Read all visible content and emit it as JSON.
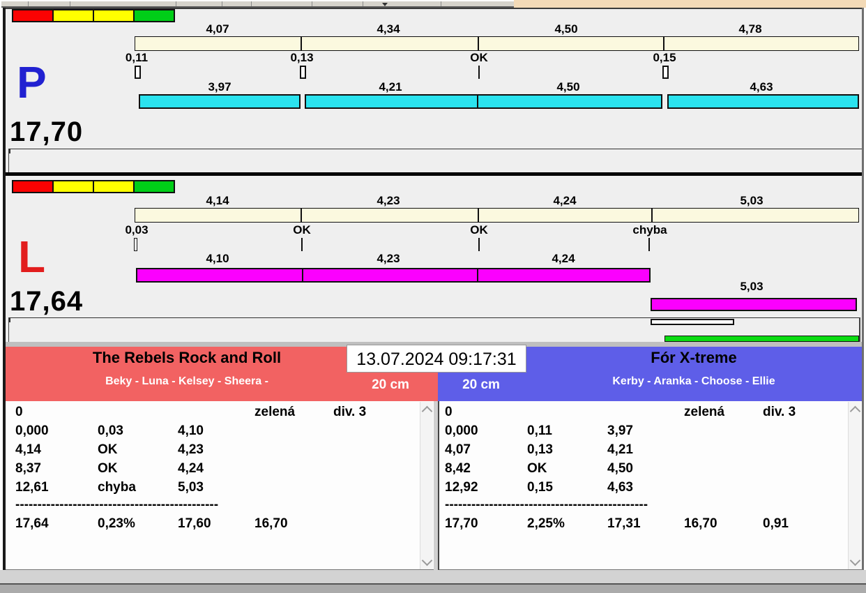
{
  "legend_colors": [
    "#FA0202",
    "#FFFF00",
    "#FFFF00",
    "#00CE18"
  ],
  "lanes": {
    "p": {
      "letter": "P",
      "letter_color": "#2121D1",
      "total": "17,70",
      "bar_color": "#2BE3EF",
      "upper": [
        "4,07",
        "4,34",
        "4,50",
        "4,78"
      ],
      "ticks": [
        {
          "label": "0,11"
        },
        {
          "label": "0,13"
        },
        {
          "label": "OK"
        },
        {
          "label": "0,15"
        }
      ],
      "lower": [
        "3,97",
        "4,21",
        "4,50",
        "4,63"
      ]
    },
    "l": {
      "letter": "L",
      "letter_color": "#E21D1D",
      "total": "17,64",
      "bar_color": "#FB00FE",
      "upper": [
        "4,14",
        "4,23",
        "4,24",
        "5,03"
      ],
      "ticks": [
        {
          "label": "0,03"
        },
        {
          "label": "OK"
        },
        {
          "label": "OK"
        },
        {
          "label": "chyba"
        }
      ],
      "lower": [
        "4,10",
        "4,23",
        "4,24"
      ],
      "overflow_label": "5,03",
      "rerun_bar_color": "#0BDC12"
    }
  },
  "timestamp": "13.07.2024 09:17:31",
  "teams": {
    "left": {
      "name": "The Rebels Rock and Roll",
      "dogs": "Beky - Luna - Kelsey - Sheera -",
      "height_class": "20 cm",
      "header_color": "#F26262",
      "rows": [
        [
          "0",
          "",
          "",
          "zelená",
          "div. 3"
        ],
        [
          "0,000",
          "0,03",
          "4,10"
        ],
        [
          "4,14",
          "OK",
          "4,23"
        ],
        [
          "8,37",
          "OK",
          "4,24"
        ],
        [
          "12,61",
          "chyba",
          "5,03"
        ]
      ],
      "separator": "----------------------------------------------",
      "totals": [
        "17,64",
        "0,23%",
        "17,60",
        "16,70"
      ]
    },
    "right": {
      "name": "Fór X-treme",
      "dogs": "Kerby - Aranka - Choose - Ellie",
      "height_class": "20 cm",
      "header_color": "#5E5EE8",
      "rows": [
        [
          "0",
          "",
          "",
          "zelená",
          "div. 3"
        ],
        [
          "0,000",
          "0,11",
          "3,97"
        ],
        [
          "4,07",
          "0,13",
          "4,21"
        ],
        [
          "8,42",
          "OK",
          "4,50"
        ],
        [
          "12,92",
          "0,15",
          "4,63"
        ]
      ],
      "separator": "----------------------------------------------",
      "totals": [
        "17,70",
        "2,25%",
        "17,31",
        "16,70",
        "0,91"
      ]
    }
  }
}
